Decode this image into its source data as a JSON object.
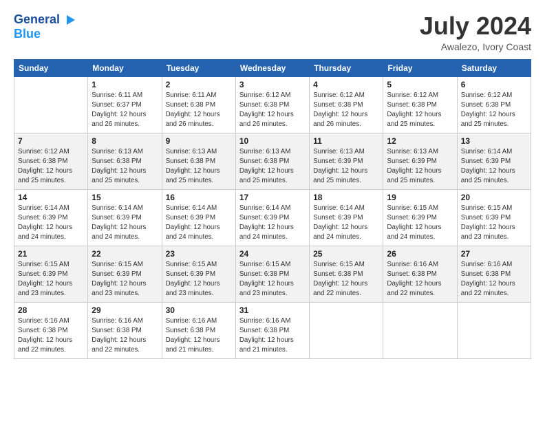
{
  "header": {
    "logo_line1": "General",
    "logo_line2": "Blue",
    "month_title": "July 2024",
    "location": "Awalezo, Ivory Coast"
  },
  "weekdays": [
    "Sunday",
    "Monday",
    "Tuesday",
    "Wednesday",
    "Thursday",
    "Friday",
    "Saturday"
  ],
  "weeks": [
    [
      {
        "day": "",
        "sunrise": "",
        "sunset": "",
        "daylight": ""
      },
      {
        "day": "1",
        "sunrise": "Sunrise: 6:11 AM",
        "sunset": "Sunset: 6:37 PM",
        "daylight": "Daylight: 12 hours and 26 minutes."
      },
      {
        "day": "2",
        "sunrise": "Sunrise: 6:11 AM",
        "sunset": "Sunset: 6:38 PM",
        "daylight": "Daylight: 12 hours and 26 minutes."
      },
      {
        "day": "3",
        "sunrise": "Sunrise: 6:12 AM",
        "sunset": "Sunset: 6:38 PM",
        "daylight": "Daylight: 12 hours and 26 minutes."
      },
      {
        "day": "4",
        "sunrise": "Sunrise: 6:12 AM",
        "sunset": "Sunset: 6:38 PM",
        "daylight": "Daylight: 12 hours and 26 minutes."
      },
      {
        "day": "5",
        "sunrise": "Sunrise: 6:12 AM",
        "sunset": "Sunset: 6:38 PM",
        "daylight": "Daylight: 12 hours and 25 minutes."
      },
      {
        "day": "6",
        "sunrise": "Sunrise: 6:12 AM",
        "sunset": "Sunset: 6:38 PM",
        "daylight": "Daylight: 12 hours and 25 minutes."
      }
    ],
    [
      {
        "day": "7",
        "sunrise": "Sunrise: 6:12 AM",
        "sunset": "Sunset: 6:38 PM",
        "daylight": "Daylight: 12 hours and 25 minutes."
      },
      {
        "day": "8",
        "sunrise": "Sunrise: 6:13 AM",
        "sunset": "Sunset: 6:38 PM",
        "daylight": "Daylight: 12 hours and 25 minutes."
      },
      {
        "day": "9",
        "sunrise": "Sunrise: 6:13 AM",
        "sunset": "Sunset: 6:38 PM",
        "daylight": "Daylight: 12 hours and 25 minutes."
      },
      {
        "day": "10",
        "sunrise": "Sunrise: 6:13 AM",
        "sunset": "Sunset: 6:38 PM",
        "daylight": "Daylight: 12 hours and 25 minutes."
      },
      {
        "day": "11",
        "sunrise": "Sunrise: 6:13 AM",
        "sunset": "Sunset: 6:39 PM",
        "daylight": "Daylight: 12 hours and 25 minutes."
      },
      {
        "day": "12",
        "sunrise": "Sunrise: 6:13 AM",
        "sunset": "Sunset: 6:39 PM",
        "daylight": "Daylight: 12 hours and 25 minutes."
      },
      {
        "day": "13",
        "sunrise": "Sunrise: 6:14 AM",
        "sunset": "Sunset: 6:39 PM",
        "daylight": "Daylight: 12 hours and 25 minutes."
      }
    ],
    [
      {
        "day": "14",
        "sunrise": "Sunrise: 6:14 AM",
        "sunset": "Sunset: 6:39 PM",
        "daylight": "Daylight: 12 hours and 24 minutes."
      },
      {
        "day": "15",
        "sunrise": "Sunrise: 6:14 AM",
        "sunset": "Sunset: 6:39 PM",
        "daylight": "Daylight: 12 hours and 24 minutes."
      },
      {
        "day": "16",
        "sunrise": "Sunrise: 6:14 AM",
        "sunset": "Sunset: 6:39 PM",
        "daylight": "Daylight: 12 hours and 24 minutes."
      },
      {
        "day": "17",
        "sunrise": "Sunrise: 6:14 AM",
        "sunset": "Sunset: 6:39 PM",
        "daylight": "Daylight: 12 hours and 24 minutes."
      },
      {
        "day": "18",
        "sunrise": "Sunrise: 6:14 AM",
        "sunset": "Sunset: 6:39 PM",
        "daylight": "Daylight: 12 hours and 24 minutes."
      },
      {
        "day": "19",
        "sunrise": "Sunrise: 6:15 AM",
        "sunset": "Sunset: 6:39 PM",
        "daylight": "Daylight: 12 hours and 24 minutes."
      },
      {
        "day": "20",
        "sunrise": "Sunrise: 6:15 AM",
        "sunset": "Sunset: 6:39 PM",
        "daylight": "Daylight: 12 hours and 23 minutes."
      }
    ],
    [
      {
        "day": "21",
        "sunrise": "Sunrise: 6:15 AM",
        "sunset": "Sunset: 6:39 PM",
        "daylight": "Daylight: 12 hours and 23 minutes."
      },
      {
        "day": "22",
        "sunrise": "Sunrise: 6:15 AM",
        "sunset": "Sunset: 6:39 PM",
        "daylight": "Daylight: 12 hours and 23 minutes."
      },
      {
        "day": "23",
        "sunrise": "Sunrise: 6:15 AM",
        "sunset": "Sunset: 6:39 PM",
        "daylight": "Daylight: 12 hours and 23 minutes."
      },
      {
        "day": "24",
        "sunrise": "Sunrise: 6:15 AM",
        "sunset": "Sunset: 6:38 PM",
        "daylight": "Daylight: 12 hours and 23 minutes."
      },
      {
        "day": "25",
        "sunrise": "Sunrise: 6:15 AM",
        "sunset": "Sunset: 6:38 PM",
        "daylight": "Daylight: 12 hours and 22 minutes."
      },
      {
        "day": "26",
        "sunrise": "Sunrise: 6:16 AM",
        "sunset": "Sunset: 6:38 PM",
        "daylight": "Daylight: 12 hours and 22 minutes."
      },
      {
        "day": "27",
        "sunrise": "Sunrise: 6:16 AM",
        "sunset": "Sunset: 6:38 PM",
        "daylight": "Daylight: 12 hours and 22 minutes."
      }
    ],
    [
      {
        "day": "28",
        "sunrise": "Sunrise: 6:16 AM",
        "sunset": "Sunset: 6:38 PM",
        "daylight": "Daylight: 12 hours and 22 minutes."
      },
      {
        "day": "29",
        "sunrise": "Sunrise: 6:16 AM",
        "sunset": "Sunset: 6:38 PM",
        "daylight": "Daylight: 12 hours and 22 minutes."
      },
      {
        "day": "30",
        "sunrise": "Sunrise: 6:16 AM",
        "sunset": "Sunset: 6:38 PM",
        "daylight": "Daylight: 12 hours and 21 minutes."
      },
      {
        "day": "31",
        "sunrise": "Sunrise: 6:16 AM",
        "sunset": "Sunset: 6:38 PM",
        "daylight": "Daylight: 12 hours and 21 minutes."
      },
      {
        "day": "",
        "sunrise": "",
        "sunset": "",
        "daylight": ""
      },
      {
        "day": "",
        "sunrise": "",
        "sunset": "",
        "daylight": ""
      },
      {
        "day": "",
        "sunrise": "",
        "sunset": "",
        "daylight": ""
      }
    ]
  ]
}
